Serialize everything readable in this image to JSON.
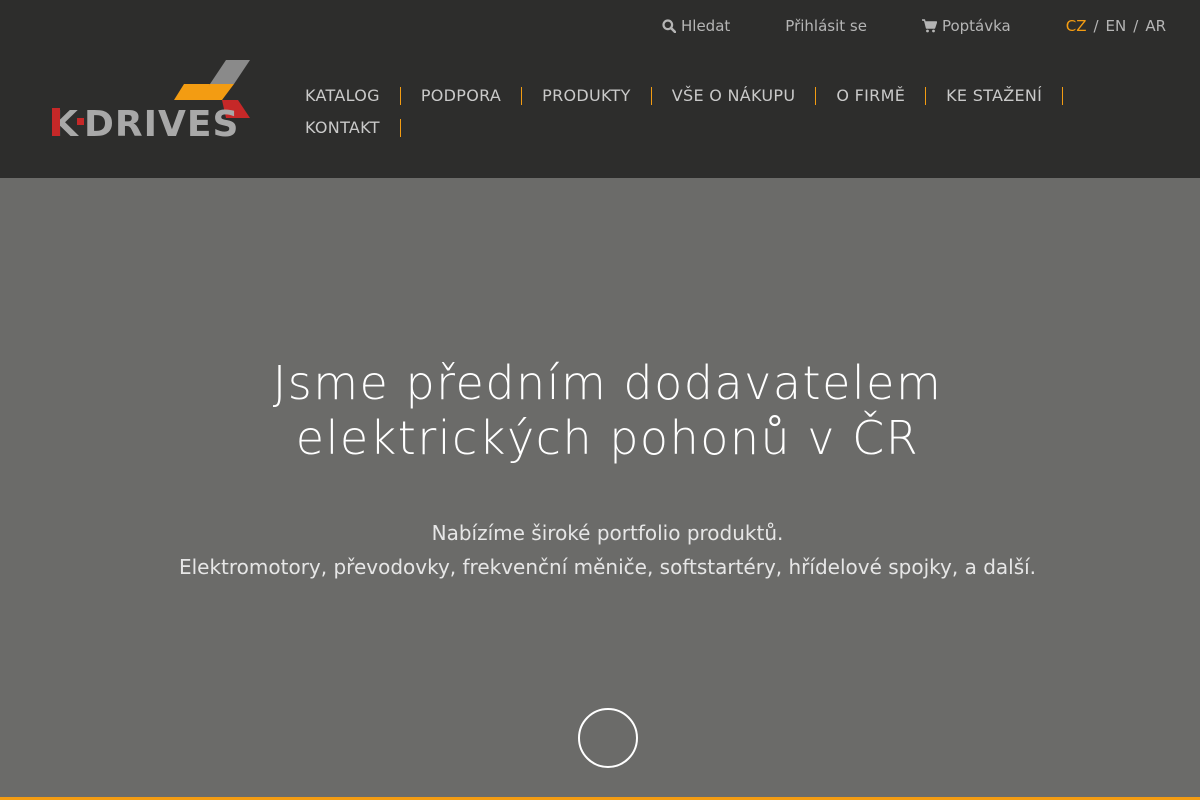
{
  "brand": {
    "name": "K-DRIVES",
    "accent": "#f39c12",
    "red": "#c62828"
  },
  "topbar": {
    "search_label": "Hledat",
    "login_label": "Přihlásit se",
    "cart_label": "Poptávka",
    "languages": [
      {
        "code": "CZ",
        "active": true
      },
      {
        "code": "EN",
        "active": false
      },
      {
        "code": "AR",
        "active": false
      }
    ],
    "lang_sep": "/"
  },
  "nav": {
    "items": [
      {
        "label": "KATALOG"
      },
      {
        "label": "PODPORA"
      },
      {
        "label": "PRODUKTY"
      },
      {
        "label": "VŠE O NÁKUPU"
      },
      {
        "label": "O FIRMĚ"
      },
      {
        "label": "KE STAŽENÍ"
      },
      {
        "label": "KONTAKT"
      }
    ]
  },
  "hero": {
    "title_line1": "Jsme předním dodavatelem",
    "title_line2": "elektrických pohonů v ČR",
    "subtitle_line1": "Nabízíme široké portfolio produktů.",
    "subtitle_line2": "Elektromotory, převodovky, frekvenční měniče, softstartéry, hřídelové spojky, a další."
  }
}
